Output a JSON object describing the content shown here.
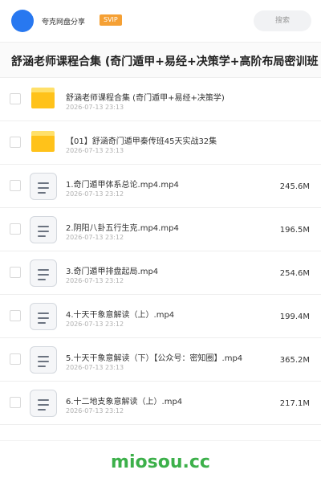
{
  "header": {
    "share_name": "夸克网盘分享",
    "badge": "SVIP",
    "search_label": "搜索"
  },
  "title": "舒涵老师课程合集 (奇门遁甲+易经+决策学+高阶布局密训班",
  "rows": [
    {
      "type": "folder",
      "name": "舒涵老师课程合集 (奇门遁甲+易经+决策学)",
      "date": "2026-07-13 23:13",
      "size": ""
    },
    {
      "type": "folder",
      "name": "【01】舒涵奇门遁甲秦传班45天实战32集",
      "date": "2026-07-13 23:13",
      "size": ""
    },
    {
      "type": "file",
      "name": "1.奇门遁甲体系总论.mp4.mp4",
      "date": "2026-07-13 23:12",
      "size": "245.6M"
    },
    {
      "type": "file",
      "name": "2.阴阳八卦五行生克.mp4.mp4",
      "date": "2026-07-13 23:12",
      "size": "196.5M"
    },
    {
      "type": "file",
      "name": "3.奇门遁甲排盘起局.mp4",
      "date": "2026-07-13 23:12",
      "size": "254.6M"
    },
    {
      "type": "file",
      "name": "4.十天干象意解读（上）.mp4",
      "date": "2026-07-13 23:12",
      "size": "199.4M"
    },
    {
      "type": "file",
      "name": "5.十天干象意解读（下）【公众号：密知圈】.mp4",
      "date": "2026-07-13 23:13",
      "size": "365.2M"
    },
    {
      "type": "file",
      "name": "6.十二地支象意解读（上）.mp4",
      "date": "2026-07-13 23:12",
      "size": "217.1M"
    }
  ],
  "watermark": "miosou.cc",
  "colors": {
    "accent": "#2878f0",
    "badge": "#f5a034",
    "folder": "#ffc21a",
    "watermark": "#3cb04a"
  },
  "icons": {
    "folder": "folder-icon",
    "file": "video-file-icon"
  }
}
